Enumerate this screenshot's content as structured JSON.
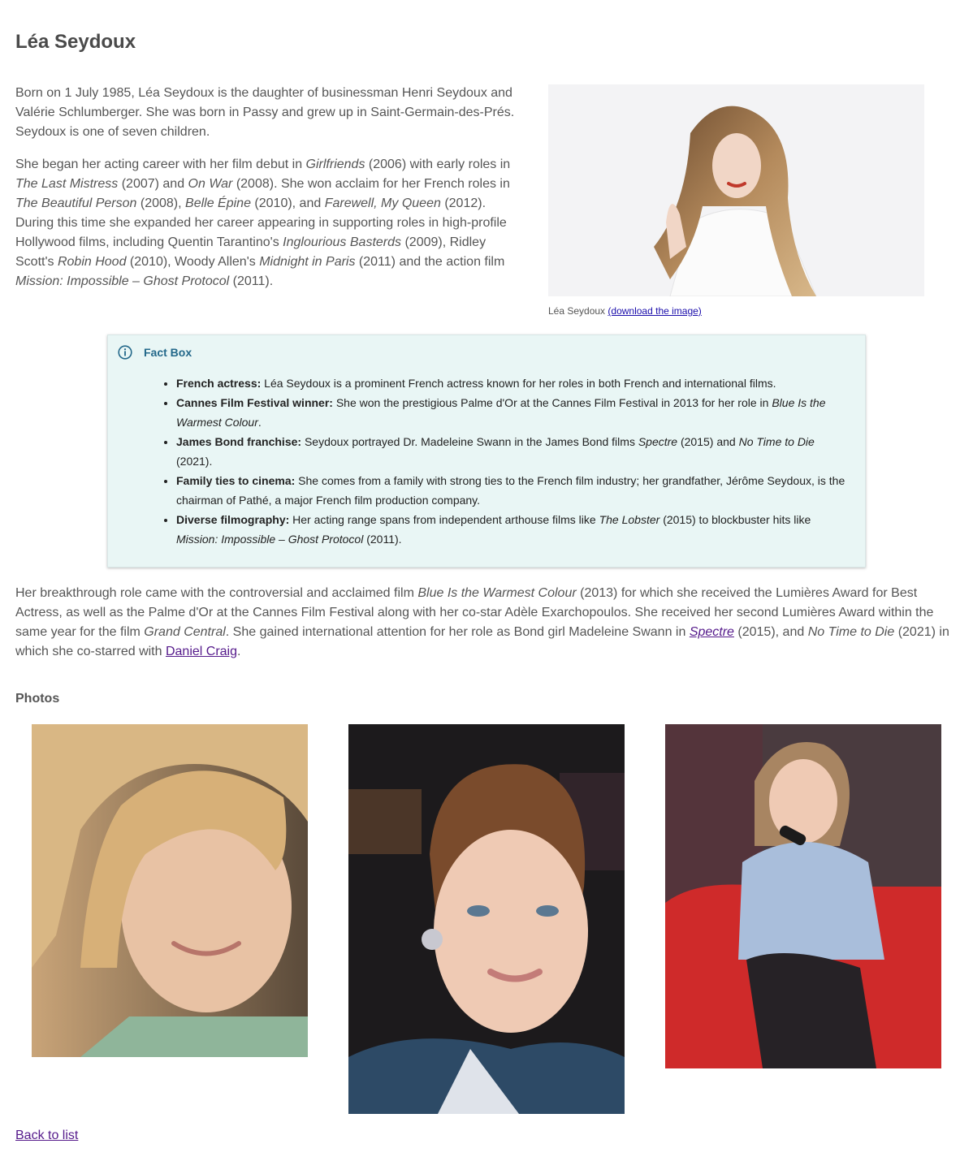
{
  "page": {
    "title": "Léa Seydoux"
  },
  "intro": {
    "p1": "Born on 1 July 1985, Léa Seydoux is the daughter of businessman Henri Seydoux and Valérie Schlumberger. She was born in Passy and grew up in Saint-Germain-des-Prés. Seydoux is one of seven children.",
    "p2": {
      "t1": "She began her acting career with her film debut in ",
      "i1": "Girlfriends",
      "t2": " (2006) with early roles in ",
      "i2": "The Last Mistress",
      "t3": " (2007) and ",
      "i3": "On War",
      "t4": " (2008). She won acclaim for her French roles in ",
      "i4": "The Beautiful Person",
      "t5": " (2008), ",
      "i5": "Belle Épine",
      "t6": " (2010), and ",
      "i6": "Farewell, My Queen",
      "t7": " (2012). During this time she expanded her career appearing in supporting roles in high-profile Hollywood films, including Quentin Tarantino's ",
      "i7": "Inglourious Basterds",
      "t8": " (2009), Ridley Scott's ",
      "i8": "Robin Hood",
      "t9": " (2010), Woody Allen's ",
      "i9": "Midnight in Paris",
      "t10": " (2011) and the action film ",
      "i10": "Mission: Impossible – Ghost Protocol",
      "t11": " (2011)."
    }
  },
  "hero": {
    "caption": "Léa Seydoux",
    "download_link": "(download the image)"
  },
  "factbox": {
    "title": "Fact Box",
    "icon": "info-circle-icon",
    "items": [
      {
        "label": "French actress:",
        "text": " Léa Seydoux is a prominent French actress known for her roles in both French and international films."
      },
      {
        "label": "Cannes Film Festival winner:",
        "text": " She won the prestigious Palme d'Or at the Cannes Film Festival in 2013 for her role in ",
        "italic": "Blue Is the Warmest Colour",
        "tail": "."
      },
      {
        "label": "James Bond franchise:",
        "text": " Seydoux portrayed Dr. Madeleine Swann in the James Bond films ",
        "italic": "Spectre",
        "mid": " (2015) and ",
        "italic2": "No Time to Die",
        "tail": " (2021)."
      },
      {
        "label": "Family ties to cinema:",
        "text": " She comes from a family with strong ties to the French film industry; her grandfather, Jérôme Seydoux, is the chairman of Pathé, a major French film production company."
      },
      {
        "label": "Diverse filmography:",
        "text": " Her acting range spans from independent arthouse films like ",
        "italic": "The Lobster",
        "mid": " (2015) to blockbuster hits like ",
        "italic2": "Mission: Impossible – Ghost Protocol",
        "tail": " (2011)."
      }
    ]
  },
  "breakthrough": {
    "t1": "Her breakthrough role came with the controversial and acclaimed film ",
    "i1": "Blue Is the Warmest Colour",
    "t2": " (2013) for which she received the Lumières Award for Best Actress, as well as the Palme d'Or at the Cannes Film Festival along with her co-star Adèle Exarchopoulos. She received her second Lumières Award within the same year for the film ",
    "i2": "Grand Central",
    "t3": ". She gained international attention for her role as Bond girl Madeleine Swann in ",
    "link1": "Spectre",
    "t4": " (2015), and ",
    "i3": "No Time to Die",
    "t5": " (2021) in which she co-starred with ",
    "link2": "Daniel Craig",
    "t6": "."
  },
  "photos": {
    "title": "Photos"
  },
  "footer": {
    "back_link": "Back to list"
  },
  "colors": {
    "factbox_bg": "#e9f6f5",
    "factbox_title": "#23688a",
    "visited_link": "#551a8b",
    "link": "#1a0dab"
  }
}
